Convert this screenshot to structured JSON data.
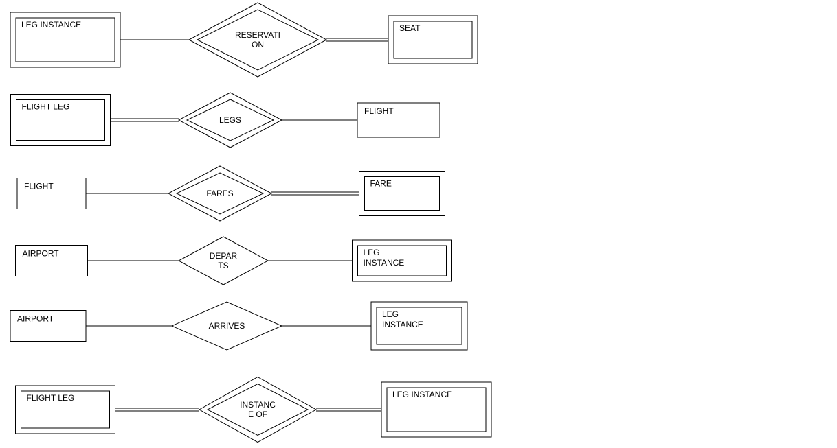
{
  "diagram": {
    "rows": [
      {
        "left_entity": {
          "label": "LEG INSTANCE",
          "weak": true
        },
        "relationship": {
          "label1": "RESERVATI",
          "label2": "ON",
          "identifying": true
        },
        "right_entity": {
          "label": "SEAT",
          "weak": true
        },
        "left_link_double": false,
        "right_link_double": true
      },
      {
        "left_entity": {
          "label": "FLIGHT LEG",
          "weak": true
        },
        "relationship": {
          "label1": "LEGS",
          "label2": "",
          "identifying": true
        },
        "right_entity": {
          "label": "FLIGHT",
          "weak": false
        },
        "left_link_double": true,
        "right_link_double": false
      },
      {
        "left_entity": {
          "label": "FLIGHT",
          "weak": false
        },
        "relationship": {
          "label1": "FARES",
          "label2": "",
          "identifying": true
        },
        "right_entity": {
          "label": "FARE",
          "weak": true
        },
        "left_link_double": false,
        "right_link_double": true
      },
      {
        "left_entity": {
          "label": "AIRPORT",
          "weak": false
        },
        "relationship": {
          "label1": "DEPAR",
          "label2": "TS",
          "identifying": false
        },
        "right_entity": {
          "label": "LEG",
          "label2": "INSTANCE",
          "weak": true
        },
        "left_link_double": false,
        "right_link_double": false
      },
      {
        "left_entity": {
          "label": "AIRPORT",
          "weak": false
        },
        "relationship": {
          "label1": "ARRIVES",
          "label2": "",
          "identifying": false
        },
        "right_entity": {
          "label": "LEG",
          "label2": "INSTANCE",
          "weak": true
        },
        "left_link_double": false,
        "right_link_double": false
      },
      {
        "left_entity": {
          "label": "FLIGHT LEG",
          "weak": true
        },
        "relationship": {
          "label1": "INSTANC",
          "label2": "E OF",
          "identifying": true
        },
        "right_entity": {
          "label": "LEG INSTANCE",
          "weak": true
        },
        "left_link_double": true,
        "right_link_double": true
      }
    ]
  }
}
